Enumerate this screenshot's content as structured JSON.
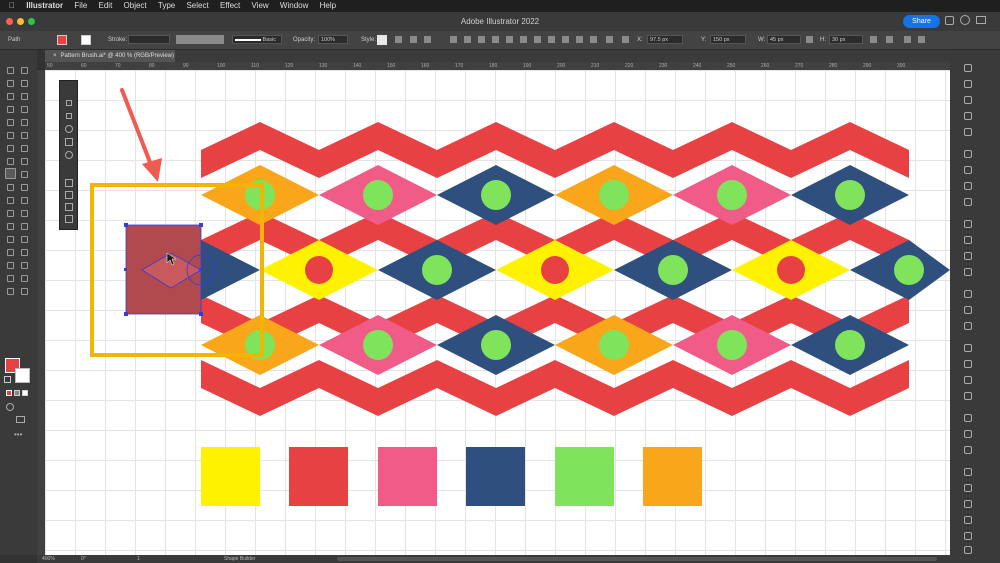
{
  "menu": {
    "app": "Illustrator",
    "items": [
      "File",
      "Edit",
      "Object",
      "Type",
      "Select",
      "Effect",
      "View",
      "Window",
      "Help"
    ]
  },
  "window": {
    "title": "Adobe Illustrator 2022",
    "share_label": "Share"
  },
  "control": {
    "selection": "Path",
    "stroke_label": "Stroke:",
    "brush": "Basic",
    "opacity_label": "Opacity:",
    "opacity_value": "100%",
    "style_label": "Style:",
    "x_label": "X:",
    "x_value": "97.5 px",
    "y_label": "Y:",
    "y_value": "150 px",
    "w_label": "W:",
    "w_value": "45 px",
    "h_label": "H:",
    "h_value": "30 px"
  },
  "document": {
    "tab_title": "Pattern Brush.ai* @ 400 % (RGB/Preview)"
  },
  "ruler": {
    "ticks": [
      "50",
      "60",
      "70",
      "80",
      "90",
      "100",
      "110",
      "120",
      "130",
      "140",
      "150",
      "160",
      "170",
      "180",
      "190",
      "200",
      "210",
      "220",
      "230",
      "240",
      "250",
      "260",
      "270",
      "280",
      "290",
      "300"
    ]
  },
  "status": {
    "zoom": "400%",
    "rotation": "0°",
    "artboard": "1",
    "tool": "Shape Builder"
  },
  "colors": {
    "red": "#e84144",
    "yellow": "#fff200",
    "pink": "#f05c87",
    "navy": "#2f4f7f",
    "green": "#80e35c",
    "orange": "#f9a61a",
    "highlight": "#f4b400",
    "arrow": "#f05a50",
    "selection": "#3a3ad6"
  },
  "swatches": [
    {
      "name": "yellow",
      "color": "#fff200"
    },
    {
      "name": "red",
      "color": "#e84144"
    },
    {
      "name": "pink",
      "color": "#f05c87"
    },
    {
      "name": "navy",
      "color": "#2f4f7f"
    },
    {
      "name": "green",
      "color": "#80e35c"
    },
    {
      "name": "orange",
      "color": "#f9a61a"
    }
  ]
}
